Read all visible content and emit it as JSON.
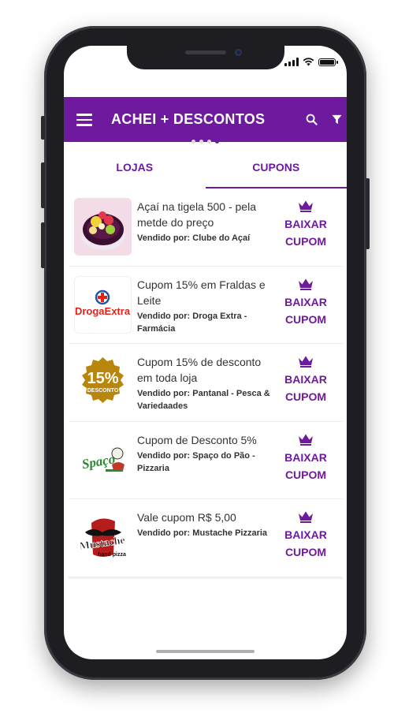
{
  "app_bar": {
    "title": "ACHEI + DESCONTOS",
    "menu_icon": "menu-icon",
    "search_icon": "search-icon",
    "filter_icon": "filter-icon",
    "color": "#6e1a9e"
  },
  "tabs": [
    {
      "label": "LOJAS",
      "active": false
    },
    {
      "label": "CUPONS",
      "active": true
    }
  ],
  "coupons": [
    {
      "title": "Açaí na tigela 500 - pela metde do preço",
      "seller": "Vendido por: Clube do Açaí",
      "action": "BAIXAR CUPOM",
      "thumb": "acai-bowl"
    },
    {
      "title": "Cupom 15% em Fraldas e Leite",
      "seller": "Vendido por: Droga Extra - Farmácia",
      "action": "BAIXAR CUPOM",
      "thumb": "droga-extra-logo",
      "logo_text": "DrogaExtra"
    },
    {
      "title": "Cupom 15% de desconto em toda loja",
      "seller": "Vendido por: Pantanal - Pesca & Variedaades",
      "action": "BAIXAR CUPOM",
      "thumb": "discount-badge",
      "badge_text": "15%",
      "badge_sub": "DESCONTO"
    },
    {
      "title": "Cupom de Desconto 5%",
      "seller": "Vendido por: Spaço do Pão - Pizzaria",
      "action": "BAIXAR CUPOM",
      "thumb": "spaco-logo",
      "logo_text": "Spaço"
    },
    {
      "title": "Vale cupom R$ 5,00",
      "seller": "Vendido por: Mustache Pizzaria",
      "action": "BAIXAR CUPOM",
      "thumb": "mustache-logo",
      "logo_text": "Mustache",
      "logo_sub": "hand pizza"
    }
  ]
}
